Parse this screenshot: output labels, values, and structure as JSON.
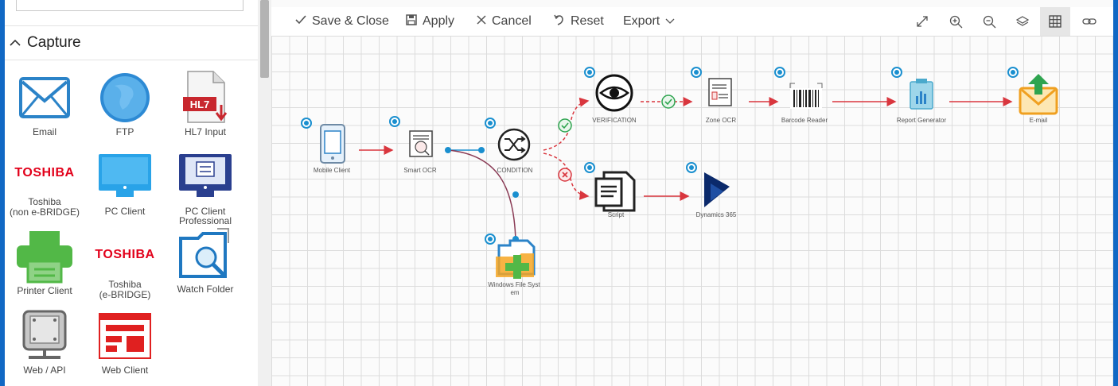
{
  "sidebar": {
    "section_title": "Capture",
    "tiles": [
      {
        "label": "Email",
        "icon": "envelope-icon"
      },
      {
        "label": "FTP",
        "icon": "globe-icon"
      },
      {
        "label": "HL7 Input",
        "icon": "hl7-document-icon",
        "badge": "HL7"
      },
      {
        "label": "Toshiba\n(non e-BRIDGE)",
        "icon": "toshiba-logo",
        "logo_text": "TOSHIBA"
      },
      {
        "label": "PC Client",
        "icon": "monitor-icon"
      },
      {
        "label": "PC Client\nProfessional",
        "icon": "monitor-settings-icon"
      },
      {
        "label": "Printer Client",
        "icon": "printer-icon"
      },
      {
        "label": "Toshiba\n(e-BRIDGE)",
        "icon": "toshiba-logo",
        "logo_text": "TOSHIBA"
      },
      {
        "label": "Watch Folder",
        "icon": "folder-search-icon"
      },
      {
        "label": "Web / API",
        "icon": "server-icon"
      },
      {
        "label": "Web Client",
        "icon": "web-form-icon"
      }
    ]
  },
  "toolbar": {
    "save_close": "Save & Close",
    "apply": "Apply",
    "cancel": "Cancel",
    "reset": "Reset",
    "export": "Export",
    "right_icons": [
      "expand-icon",
      "zoom-in-icon",
      "zoom-out-icon",
      "layers-icon",
      "grid-icon",
      "link-icon"
    ]
  },
  "workflow": {
    "nodes": [
      {
        "label": "Mobile Client",
        "icon": "mobile-phone-icon"
      },
      {
        "label": "Smart OCR",
        "icon": "smart-ocr-icon"
      },
      {
        "label": "CONDITION",
        "icon": "shuffle-icon"
      },
      {
        "label": "VERIFICATION",
        "icon": "eye-icon"
      },
      {
        "label": "Zone OCR",
        "icon": "zone-ocr-icon"
      },
      {
        "label": "Barcode Reader",
        "icon": "barcode-icon"
      },
      {
        "label": "Report Generator",
        "icon": "clipboard-chart-icon"
      },
      {
        "label": "E-mail",
        "icon": "email-upload-icon"
      },
      {
        "label": "Script",
        "icon": "script-document-icon"
      },
      {
        "label": "Dynamics 365",
        "icon": "dynamics-logo"
      },
      {
        "label": "Windows File Syst\nem",
        "icon": "file-system-icon"
      }
    ],
    "colors": {
      "connector": "#d9363e",
      "condition_line": "#8a3b55",
      "handle": "#1a8fcf",
      "success": "#2ea44f",
      "failure": "#d9363e"
    }
  }
}
